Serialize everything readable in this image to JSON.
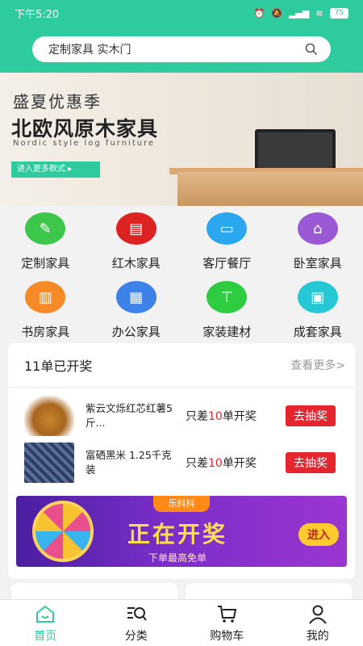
{
  "status": {
    "time": "下午5:20",
    "battery": "75"
  },
  "search": {
    "text": "定制家具  实木门"
  },
  "banner": {
    "line1": "盛夏优惠季",
    "line2": "北欧风原木家具",
    "line3": "Nordic style log furniture",
    "button": "进入更多款式 ▸"
  },
  "categories": [
    {
      "label": "定制家具",
      "icon": "pencil-ruler-icon",
      "color": "#3cc74a"
    },
    {
      "label": "红木家具",
      "icon": "cabinet-icon",
      "color": "#dd2222"
    },
    {
      "label": "客厅餐厅",
      "icon": "sofa-icon",
      "color": "#2aa7ee"
    },
    {
      "label": "卧室家具",
      "icon": "bed-icon",
      "color": "#9b59d6"
    },
    {
      "label": "书房家具",
      "icon": "desk-icon",
      "color": "#f58a26"
    },
    {
      "label": "办公家具",
      "icon": "office-desk-icon",
      "color": "#3c82e8"
    },
    {
      "label": "家装建材",
      "icon": "faucet-icon",
      "color": "#2ecc40"
    },
    {
      "label": "成套家具",
      "icon": "furniture-set-icon",
      "color": "#25c9d6"
    }
  ],
  "lottery": {
    "title": "11单已开奖",
    "more": "查看更多>",
    "items": [
      {
        "name": "紫云文烁红芯红薯5斤...",
        "need_prefix": "只差",
        "need_num": "10",
        "need_suffix": "单开奖",
        "button": "去抽奖"
      },
      {
        "name": "富硒黑米 1.25千克装",
        "need_prefix": "只差",
        "need_num": "10",
        "need_suffix": "单开奖",
        "button": "去抽奖"
      }
    ],
    "promo": {
      "brand": "乐抖抖",
      "headline": "正在开奖",
      "sub": "下单最高免单",
      "enter": "进入"
    }
  },
  "tabbar": [
    {
      "label": "首页",
      "icon": "home-icon",
      "active": true
    },
    {
      "label": "分类",
      "icon": "category-search-icon",
      "active": false
    },
    {
      "label": "购物车",
      "icon": "cart-icon",
      "active": false
    },
    {
      "label": "我的",
      "icon": "user-icon",
      "active": false
    }
  ],
  "colors": {
    "brand": "#2ecb9e",
    "accent": "#e6262e"
  }
}
